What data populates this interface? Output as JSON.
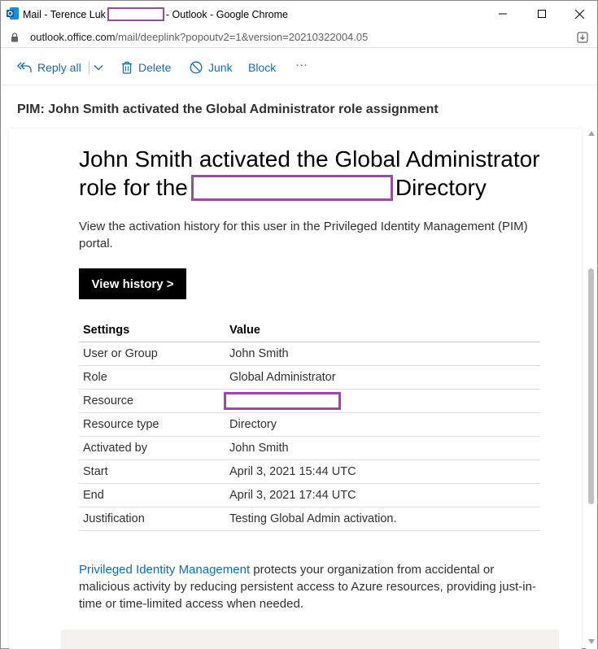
{
  "window": {
    "title_prefix": "Mail - Terence Luk",
    "title_suffix": "- Outlook - Google Chrome"
  },
  "address": {
    "host": "outlook.office.com",
    "path": "/mail/deeplink?popoutv2=1&version=20210322004.05"
  },
  "toolbar": {
    "reply_all": "Reply all",
    "delete": "Delete",
    "junk": "Junk",
    "block": "Block",
    "more": "···"
  },
  "message": {
    "subject": "PIM: John Smith activated the Global Administrator role assignment",
    "heading_part1": "John Smith activated the Global Administrator role for the",
    "heading_part2": "Directory",
    "intro": "View the activation history for this user in the Privileged Identity Management (PIM) portal.",
    "cta_label": "View history >",
    "table": {
      "headers": [
        "Settings",
        "Value"
      ],
      "rows": [
        {
          "setting": "User or Group",
          "value": "John Smith"
        },
        {
          "setting": "Role",
          "value": "Global Administrator"
        },
        {
          "setting": "Resource",
          "value": ""
        },
        {
          "setting": "Resource type",
          "value": "Directory"
        },
        {
          "setting": "Activated by",
          "value": "John Smith"
        },
        {
          "setting": "Start",
          "value": "April 3, 2021 15:44 UTC"
        },
        {
          "setting": "End",
          "value": "April 3, 2021 17:44 UTC"
        },
        {
          "setting": "Justification",
          "value": "Testing Global Admin activation."
        }
      ]
    },
    "footer_link": "Privileged Identity Management",
    "footer_text": " protects your organization from accidental or malicious activity by reducing persistent access to Azure resources, providing just-in-time or time-limited access when needed."
  },
  "colors": {
    "accent": "#0f6cbd",
    "redaction": "#9b4aa3",
    "button_bg": "#000000"
  }
}
